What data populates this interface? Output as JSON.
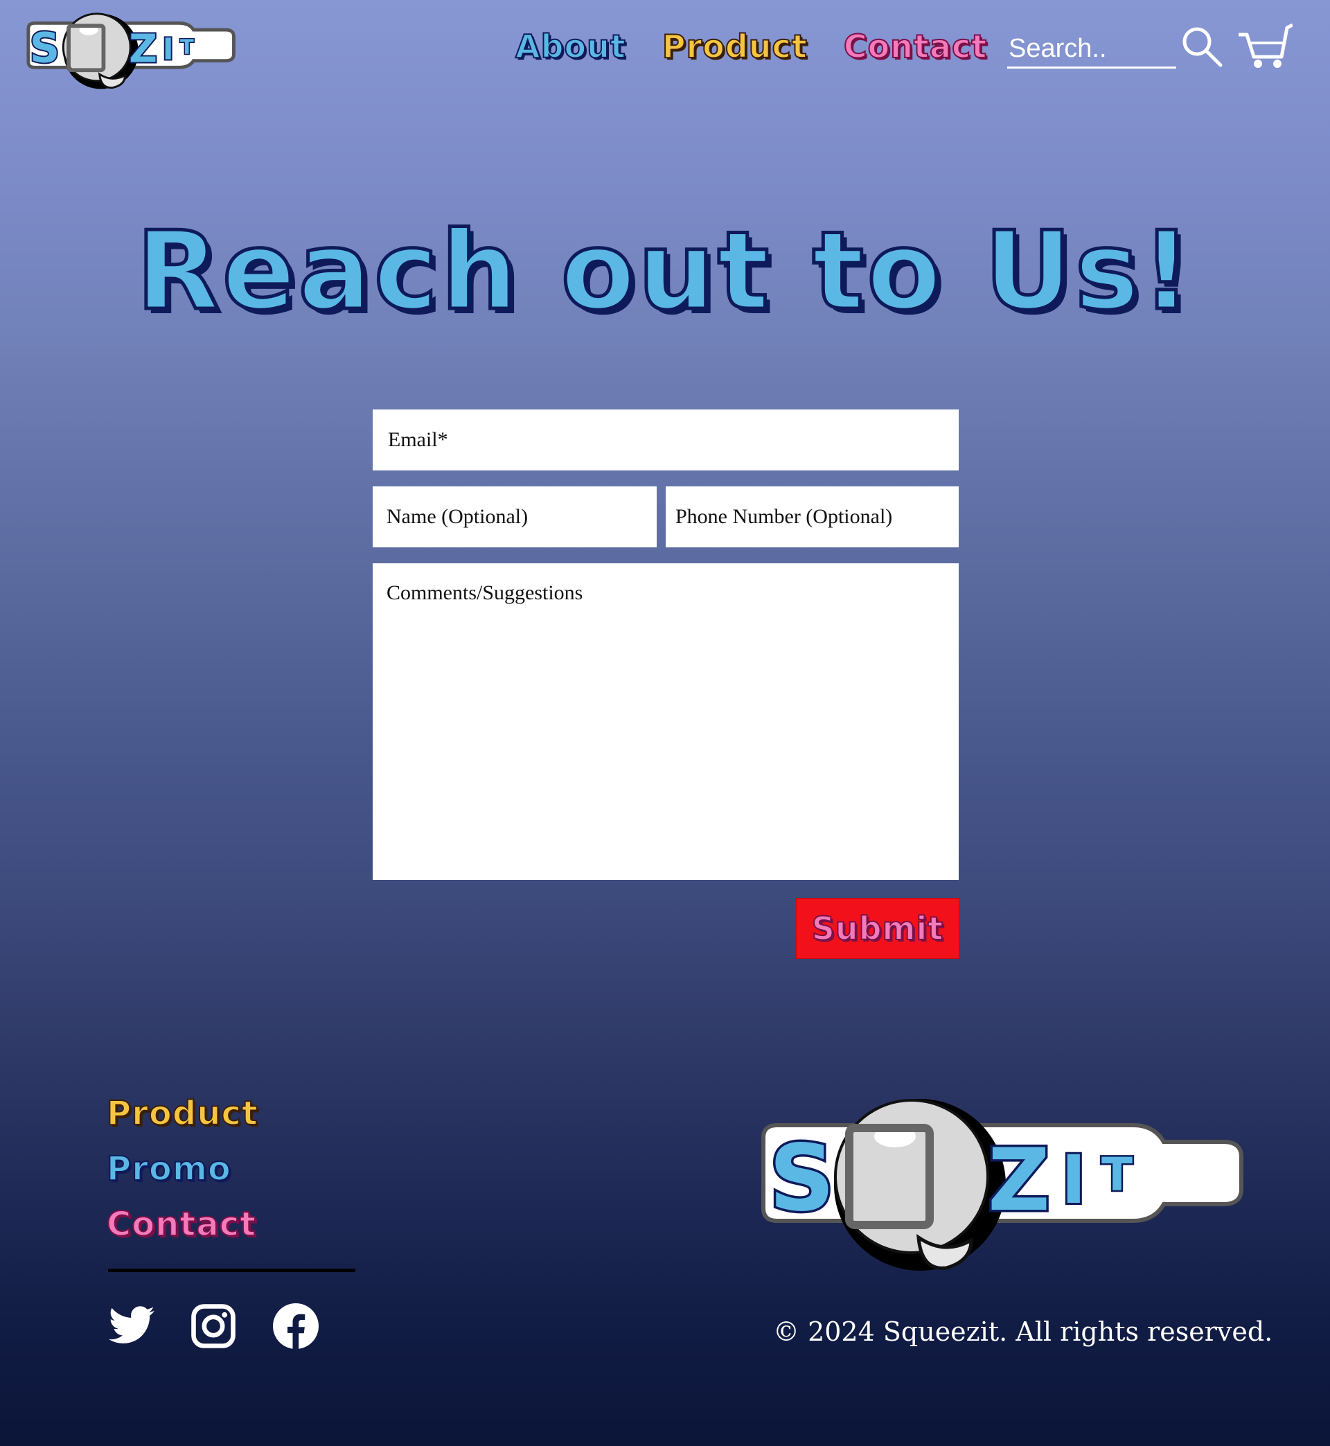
{
  "brand": {
    "logo_text": "SQZIT",
    "colors": {
      "blue": "#5bb8e4",
      "yellow": "#f5c542",
      "pink": "#f37bbb",
      "submit_red": "#f2111a"
    }
  },
  "header": {
    "nav": [
      {
        "label": "About",
        "color": "blue"
      },
      {
        "label": "Product",
        "color": "yellow"
      },
      {
        "label": "Contact",
        "color": "pink"
      }
    ],
    "search_placeholder": "Search..",
    "search_icon": "search-icon",
    "cart_icon": "cart-icon"
  },
  "main": {
    "heading": "Reach out to Us!",
    "form": {
      "email_placeholder": "Email*",
      "name_placeholder": "Name (Optional)",
      "phone_placeholder": "Phone Number (Optional)",
      "comments_placeholder": "Comments/Suggestions",
      "submit_label": "Submit"
    }
  },
  "footer": {
    "links": [
      {
        "label": "Product",
        "color": "yellow"
      },
      {
        "label": "Promo",
        "color": "blue"
      },
      {
        "label": "Contact",
        "color": "pink"
      }
    ],
    "social": [
      "twitter-icon",
      "instagram-icon",
      "facebook-icon"
    ],
    "copyright": "© 2024 Squeezit. All rights reserved."
  }
}
